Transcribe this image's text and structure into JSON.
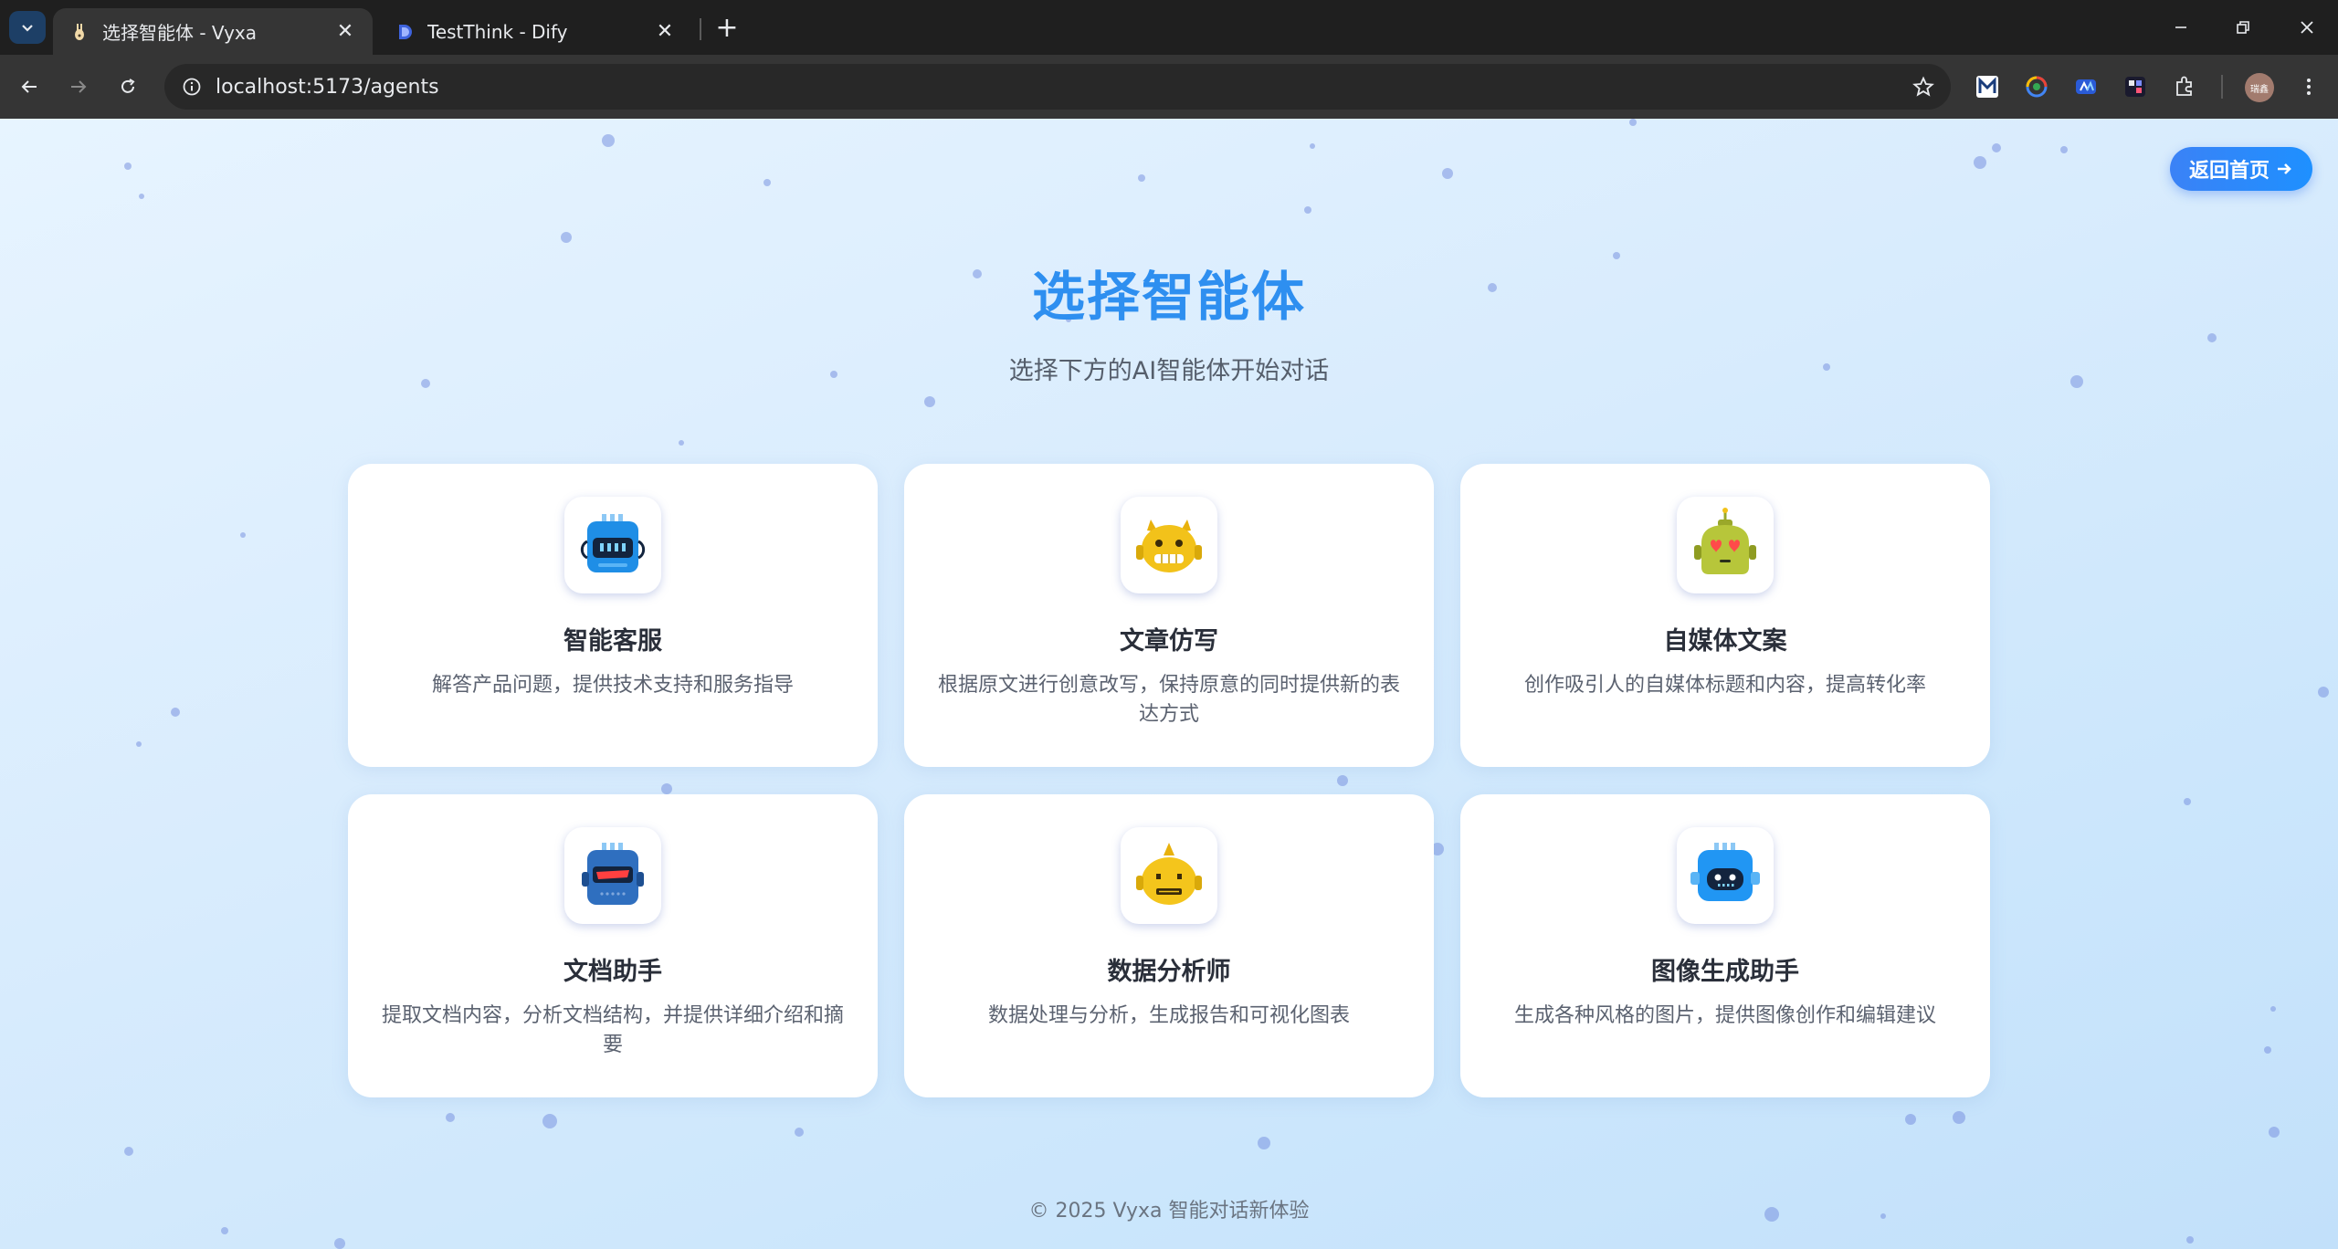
{
  "browser": {
    "tabs": [
      {
        "title": "选择智能体 - Vyxa",
        "active": true,
        "favicon": "vyxa-logo-icon"
      },
      {
        "title": "TestThink - Dify",
        "active": false,
        "favicon": "dify-logo-icon"
      }
    ],
    "url": "localhost:5173/agents",
    "profile_initials": "瑞鑫"
  },
  "page": {
    "back_button_label": "返回首页",
    "title": "选择智能体",
    "subtitle": "选择下方的AI智能体开始对话",
    "footer": "© 2025 Vyxa 智能对话新体验"
  },
  "agents": [
    {
      "name": "智能客服",
      "description": "解答产品问题，提供技术支持和服务指导",
      "avatar": "blue-robot-icon",
      "color": "#1f8ee6"
    },
    {
      "name": "文章仿写",
      "description": "根据原文进行创意改写，保持原意的同时提供新的表达方式",
      "avatar": "yellow-robot-icon",
      "color": "#f2c21a"
    },
    {
      "name": "自媒体文案",
      "description": "创作吸引人的自媒体标题和内容，提高转化率",
      "avatar": "green-robot-icon",
      "color": "#b7c63a"
    },
    {
      "name": "文档助手",
      "description": "提取文档内容，分析文档结构，并提供详细介绍和摘要",
      "avatar": "dark-blue-robot-icon",
      "color": "#2f6fbf"
    },
    {
      "name": "数据分析师",
      "description": "数据处理与分析，生成报告和可视化图表",
      "avatar": "yellow-bot-icon",
      "color": "#f4c51c"
    },
    {
      "name": "图像生成助手",
      "description": "生成各种风格的图片，提供图像创作和编辑建议",
      "avatar": "cyan-robot-icon",
      "color": "#2196f3"
    }
  ],
  "colors": {
    "accent": "#2e8ff0",
    "button": "#3b82f6",
    "card_bg": "#ffffff"
  }
}
